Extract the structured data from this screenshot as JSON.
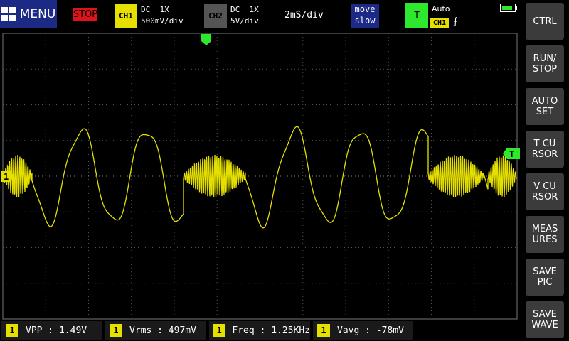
{
  "menu": {
    "label": "MENU",
    "icon": "grid-icon"
  },
  "run_state": {
    "label": "STOP",
    "color": "#e0131a"
  },
  "ch1": {
    "badge": "CH1",
    "coupling": "DC  1X",
    "scale": "500mV/div",
    "color": "#e5e000"
  },
  "ch2": {
    "badge": "CH2",
    "coupling": "DC  1X",
    "scale": "5V/div",
    "color": "#555555"
  },
  "timebase": "2mS/div",
  "move": {
    "line1": "move",
    "line2": "slow"
  },
  "trigger": {
    "badge": "T",
    "mode": "Auto",
    "source": "CH1",
    "edge": "⨍",
    "color": "#2ee82e"
  },
  "battery": {
    "icon": "battery-icon",
    "level": 0.8
  },
  "side_buttons": [
    "CTRL",
    "RUN/\nSTOP",
    "AUTO\nSET",
    "T CU\nRSOR",
    "V CU\nRSOR",
    "MEAS\nURES",
    "SAVE\nPIC",
    "SAVE\nWAVE"
  ],
  "markers": {
    "channel": "1",
    "trigger_level": "T"
  },
  "measurements": [
    {
      "num": "1",
      "label": "VPP",
      "value": "1.49V"
    },
    {
      "num": "1",
      "label": "Vrms",
      "value": "497mV"
    },
    {
      "num": "1",
      "label": "Freq",
      "value": "1.25KHz"
    },
    {
      "num": "1",
      "label": "Vavg",
      "value": "-78mV"
    }
  ]
}
